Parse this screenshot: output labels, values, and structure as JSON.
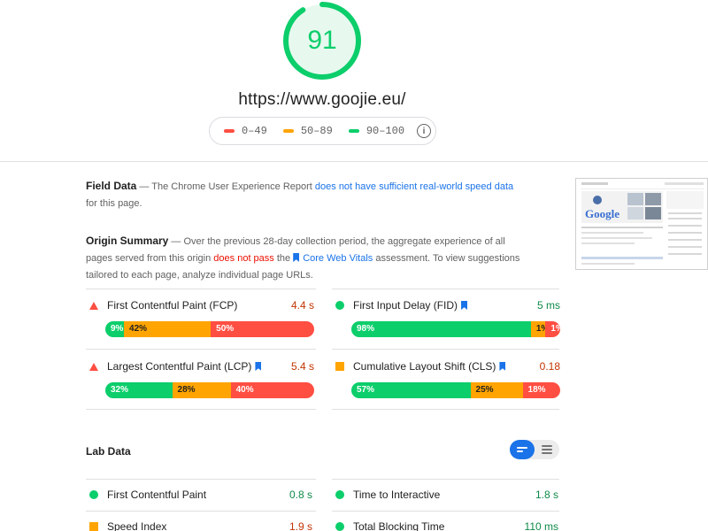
{
  "score": {
    "value": "91",
    "fraction": 0.91,
    "color": "#0cce6b"
  },
  "url": "https://www.goojie.eu/",
  "legend": [
    {
      "range": "0–49",
      "color": "#ff4e42"
    },
    {
      "range": "50–89",
      "color": "#ffa400"
    },
    {
      "range": "90–100",
      "color": "#0cce6b"
    }
  ],
  "legend_info_icon": "info-icon",
  "field_data": {
    "title": "Field Data",
    "text_1": " — The Chrome User Experience Report ",
    "link": "does not have sufficient real-world speed data",
    "text_2": " for this page."
  },
  "origin_summary": {
    "title": "Origin Summary",
    "text_1": " — Over the previous 28-day collection period, the aggregate experience of all pages served from this origin ",
    "fail": "does not pass",
    "text_2": " the ",
    "link": "Core Web Vitals",
    "text_3": " assessment. To view suggestions tailored to each page, analyze individual page URLs."
  },
  "field_metrics": [
    {
      "label": "First Contentful Paint (FCP)",
      "value": "4.4 s",
      "status": "slow",
      "core": false,
      "fast": "9%",
      "avg": "42%",
      "slow": "50%"
    },
    {
      "label": "First Input Delay (FID)",
      "value": "5 ms",
      "status": "fast",
      "core": true,
      "fast": "98%",
      "avg": "1%",
      "slow": "1%"
    },
    {
      "label": "Largest Contentful Paint (LCP)",
      "value": "5.4 s",
      "status": "slow",
      "core": true,
      "fast": "32%",
      "avg": "28%",
      "slow": "40%"
    },
    {
      "label": "Cumulative Layout Shift (CLS)",
      "value": "0.18",
      "status": "average",
      "core": true,
      "fast": "57%",
      "avg": "25%",
      "slow": "18%"
    }
  ],
  "lab_data": {
    "title": "Lab Data",
    "metrics": [
      {
        "label": "First Contentful Paint",
        "value": "0.8 s",
        "status": "fast"
      },
      {
        "label": "Time to Interactive",
        "value": "1.8 s",
        "status": "fast"
      },
      {
        "label": "Speed Index",
        "value": "1.9 s",
        "status": "average"
      },
      {
        "label": "Total Blocking Time",
        "value": "110 ms",
        "status": "fast"
      }
    ]
  },
  "colors": {
    "fast": "#0cce6b",
    "average": "#ffa400",
    "slow": "#ff4e42",
    "link": "#1a73e8"
  }
}
